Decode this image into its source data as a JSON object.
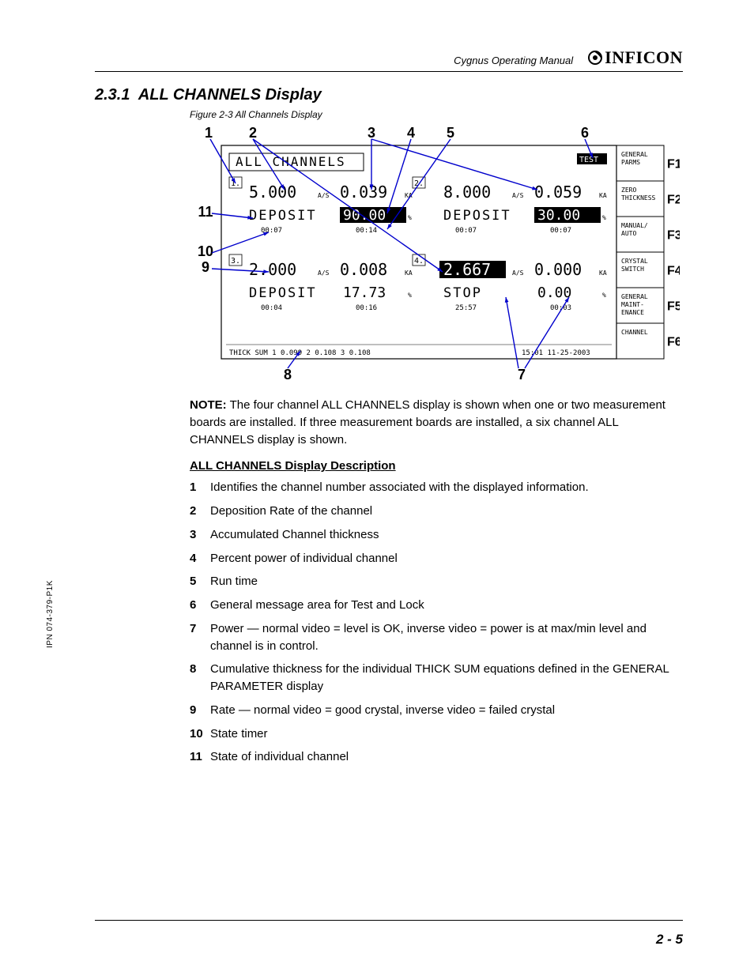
{
  "header": {
    "manual_title": "Cygnus Operating Manual",
    "brand": "INFICON"
  },
  "section": {
    "number": "2.3.1",
    "title": "ALL CHANNELS Display"
  },
  "figure": {
    "caption": "Figure 2-3  All Channels Display",
    "callouts": {
      "c1": "1",
      "c2": "2",
      "c3": "3",
      "c4": "4",
      "c5": "5",
      "c6": "6",
      "c7": "7",
      "c8": "8",
      "c9": "9",
      "c10": "10",
      "c11": "11"
    },
    "screen": {
      "panel_title": "ALL CHANNELS",
      "test_badge": "TEST",
      "quads": [
        {
          "ch": "1.",
          "rate": "5.000",
          "rate_u": "A/S",
          "thick": "0.039",
          "thick_u": "KA",
          "quad_no": "2.",
          "state": "DEPOSIT",
          "power": "90.00",
          "power_u": "%",
          "timer": "00:07",
          "timer2": "00:14",
          "rate_inv": false,
          "power_inv": true
        },
        {
          "ch": "",
          "rate": "8.000",
          "rate_u": "A/S",
          "thick": "0.059",
          "thick_u": "KA",
          "quad_no": "",
          "state": "DEPOSIT",
          "power": "30.00",
          "power_u": "%",
          "timer": "00:07",
          "timer2": "00:07",
          "rate_inv": false,
          "power_inv": true
        },
        {
          "ch": "3.",
          "rate": "2.000",
          "rate_u": "A/S",
          "thick": "0.008",
          "thick_u": "KA",
          "quad_no": "4.",
          "state": "DEPOSIT",
          "power": "17.73",
          "power_u": "%",
          "timer": "00:04",
          "timer2": "00:16",
          "rate_inv": false,
          "power_inv": false
        },
        {
          "ch": "",
          "rate": "2.667",
          "rate_u": "A/S",
          "thick": "0.000",
          "thick_u": "KA",
          "quad_no": "",
          "state": "STOP",
          "power": "0.00",
          "power_u": "%",
          "timer": "25:57",
          "timer2": "00:03",
          "rate_inv": true,
          "power_inv": false
        }
      ],
      "thicksum": "THICK SUM  1  0.099     2  0.108     3  0.108",
      "clock": "15:01 11-25-2003",
      "fkeys": [
        {
          "key": "F1",
          "label1": "GENERAL",
          "label2": "PARMS"
        },
        {
          "key": "F2",
          "label1": "ZERO",
          "label2": "THICKNESS"
        },
        {
          "key": "F3",
          "label1": "MANUAL/",
          "label2": "AUTO"
        },
        {
          "key": "F4",
          "label1": "CRYSTAL",
          "label2": "SWITCH"
        },
        {
          "key": "F5",
          "label1": "GENERAL",
          "label2": "MAINT-",
          "label3": "ENANCE"
        },
        {
          "key": "F6",
          "label1": "CHANNEL",
          "label2": ""
        }
      ]
    }
  },
  "note": {
    "label": "NOTE:",
    "text": "The four channel ALL CHANNELS display is shown when one or two measurement boards are installed. If three measurement boards are installed, a six channel ALL CHANNELS display is shown."
  },
  "desc_heading": "ALL CHANNELS Display Description",
  "desc": [
    {
      "n": "1",
      "t": "Identifies the channel number associated with the displayed information."
    },
    {
      "n": "2",
      "t": "Deposition Rate of the channel"
    },
    {
      "n": "3",
      "t": "Accumulated Channel thickness"
    },
    {
      "n": "4",
      "t": "Percent power of individual channel"
    },
    {
      "n": "5",
      "t": "Run time"
    },
    {
      "n": "6",
      "t": "General message area for Test and Lock"
    },
    {
      "n": "7",
      "t": "Power — normal video = level is OK, inverse video = power is at max/min level and channel is in control."
    },
    {
      "n": "8",
      "t": "Cumulative thickness for the individual THICK SUM equations defined in the GENERAL PARAMETER display"
    },
    {
      "n": "9",
      "t": "Rate — normal video = good crystal, inverse video = failed crystal"
    },
    {
      "n": "10",
      "t": "State timer"
    },
    {
      "n": "11",
      "t": "State of individual channel"
    }
  ],
  "side_code": "IPN 074-379-P1K",
  "page_num": "2 - 5"
}
